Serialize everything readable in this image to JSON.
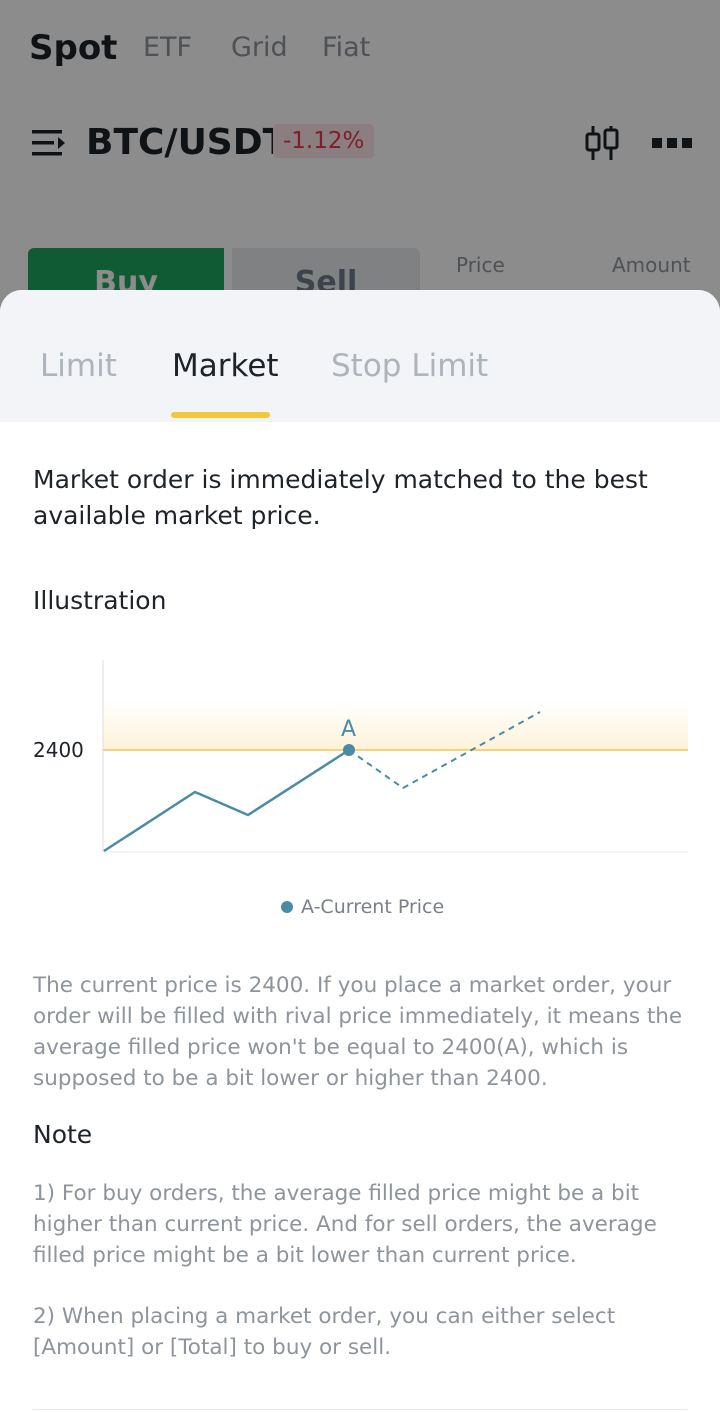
{
  "background": {
    "top_tabs": [
      "Spot",
      "ETF",
      "Grid",
      "Fiat"
    ],
    "pair": "BTC/USDT",
    "change": "-1.12%",
    "buy_label": "Buy",
    "sell_label": "Sell",
    "orderbook_headers": {
      "price": "Price\n(USDT)",
      "amount": "Amount\n(BTC)"
    },
    "icons": {
      "menu": "menu-lines-icon",
      "chart": "candlestick-icon",
      "more": "more-dots-icon"
    }
  },
  "sheet": {
    "tabs": [
      {
        "label": "Limit",
        "active": false
      },
      {
        "label": "Market",
        "active": true
      },
      {
        "label": "Stop Limit",
        "active": false
      }
    ],
    "intro": "Market order is immediately matched to the best available market price.",
    "illustration_title": "Illustration",
    "legend": "A-Current Price",
    "explain": "The current price is 2400. If you place a market order, your order will be filled with rival price immediately, it means the average filled price won't be equal to 2400(A), which is supposed to be a bit lower or higher than 2400.",
    "note_title": "Note",
    "note_1": "1) For buy orders, the average filled price might be a bit higher than current price. And for sell orders, the average filled price might be a bit lower than current price.",
    "note_2": "2) When placing a market order, you can either select [Amount] or [Total] to buy or sell."
  },
  "chart_data": {
    "type": "line",
    "y_tick": "2400",
    "point_label": "A",
    "reference_level": 2400,
    "colors": {
      "line": "#4a8ca6",
      "reference": "#f5d37a",
      "band": "#fdf3d9"
    }
  }
}
